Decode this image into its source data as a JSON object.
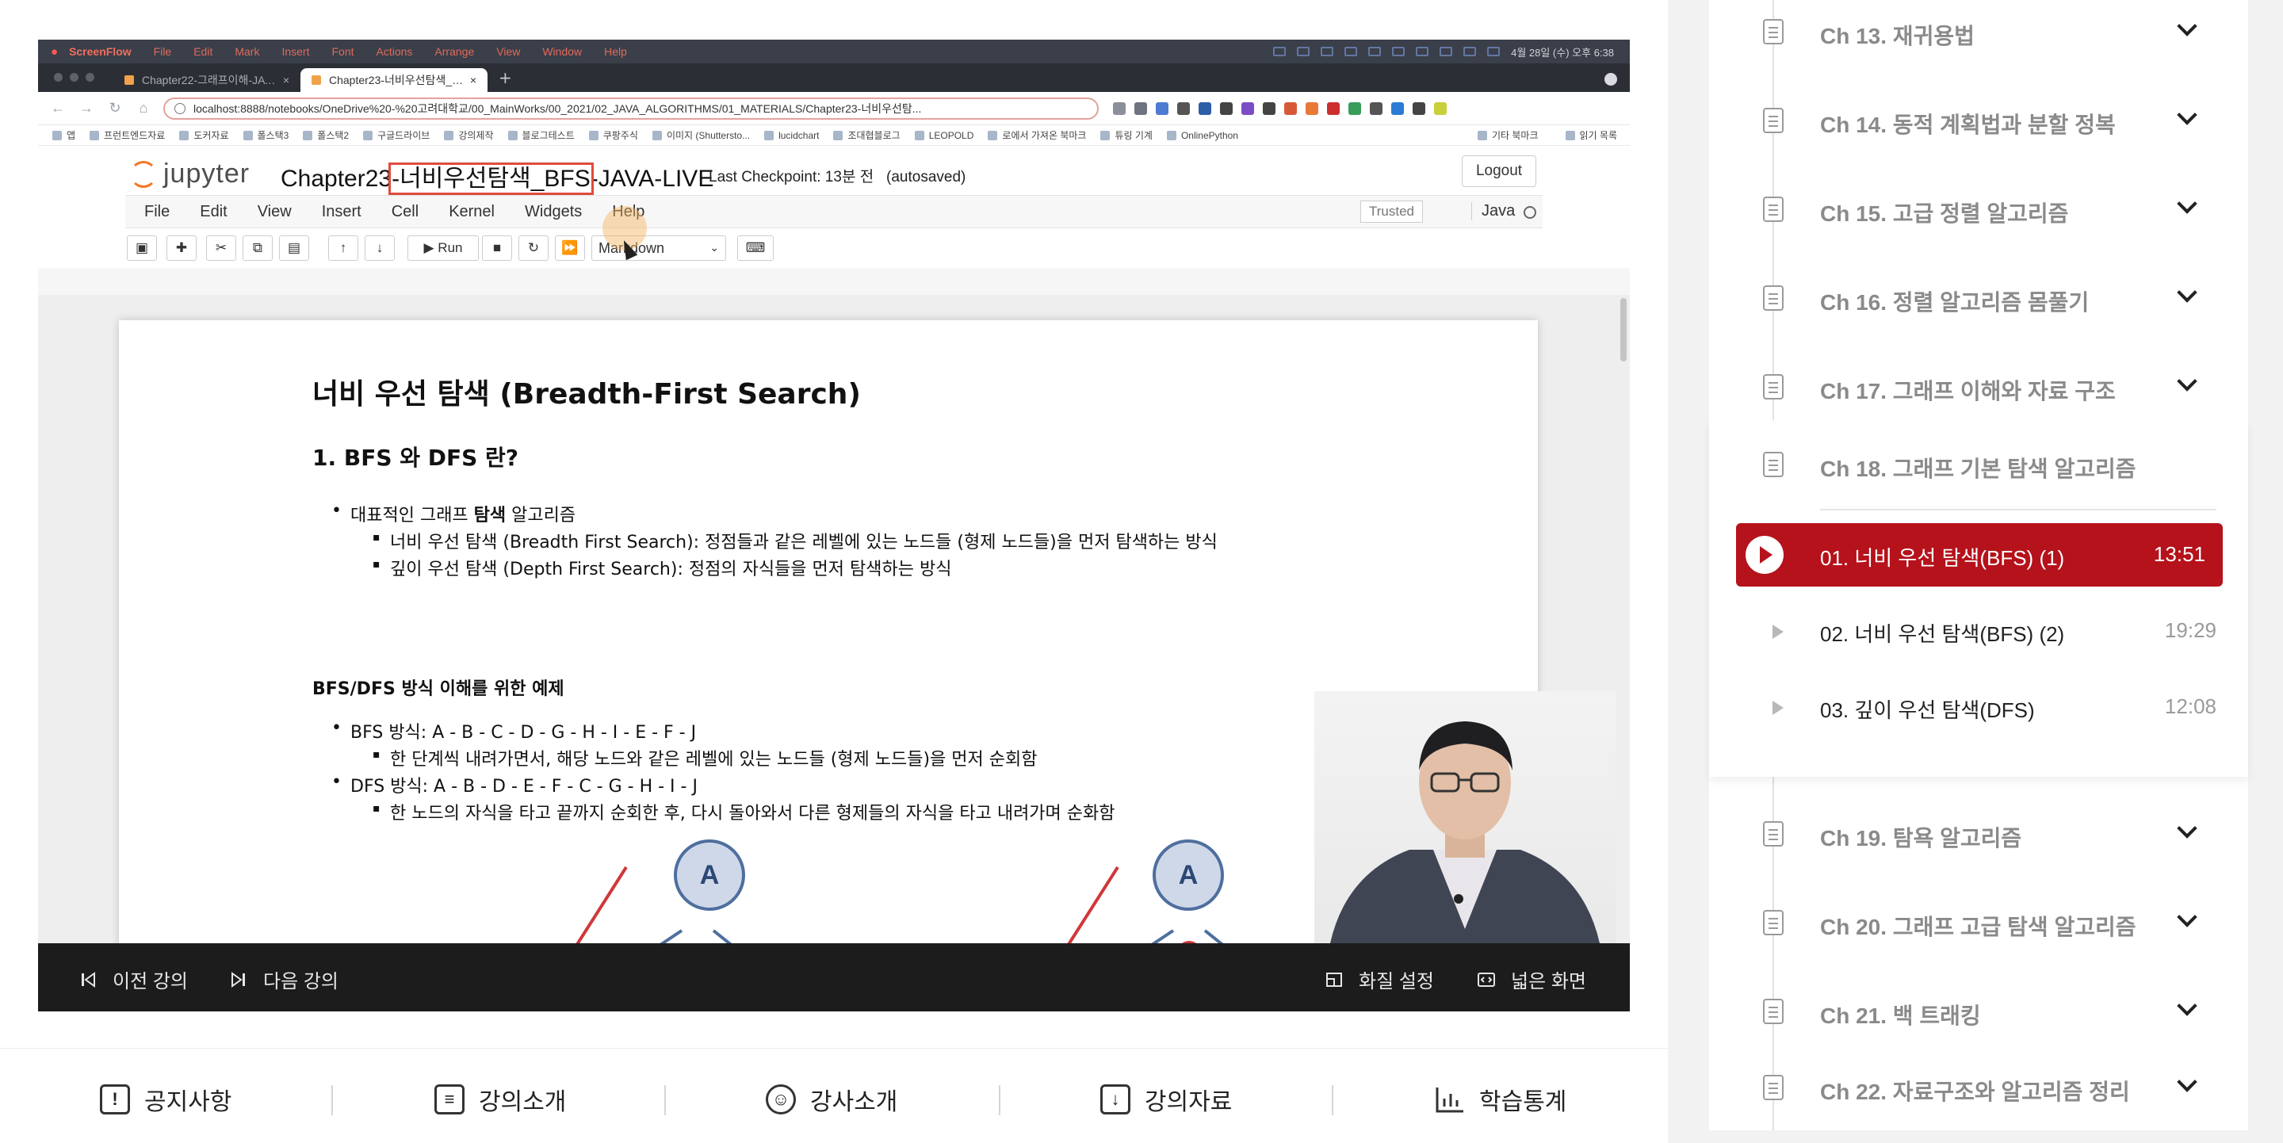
{
  "mac_menubar": {
    "app": "ScreenFlow",
    "items": [
      "File",
      "Edit",
      "Mark",
      "Insert",
      "Font",
      "Actions",
      "Arrange",
      "View",
      "Window",
      "Help"
    ],
    "clock": "4월 28일 (수) 오후 6:38"
  },
  "browser": {
    "tabs": [
      {
        "label": "Chapter22-그래프이해-JAVA - J"
      },
      {
        "label": "Chapter23-너비우선탐색_BFS-J"
      }
    ],
    "url": "localhost:8888/notebooks/OneDrive%20-%20고려대학교/00_MainWorks/00_2021/02_JAVA_ALGORITHMS/01_MATERIALS/Chapter23-너비우선탐...",
    "bookmarks": [
      "앱",
      "프런트엔드자료",
      "도커자료",
      "폴스택3",
      "폴스택2",
      "구글드라이브",
      "강의제작",
      "블로그테스트",
      "쿠팡주식",
      "이미지 (Shuttersto...",
      "lucidchart",
      "조대협블로그",
      "LEOPOLD",
      "로에서 가져온 북마크",
      "튜링 기계",
      "OnlinePython"
    ],
    "bookmarks_right": [
      "기타 북마크",
      "읽기 목록"
    ]
  },
  "jupyter": {
    "logo": "jupyter",
    "title_prefix": "Chapter23",
    "title_highlight": "-너비우선탐색_BFS",
    "title_suffix": "-JAVA-LIVE",
    "checkpoint": "Last Checkpoint: 13분 전",
    "autosaved": "(autosaved)",
    "logout": "Logout",
    "menu": [
      "File",
      "Edit",
      "View",
      "Insert",
      "Cell",
      "Kernel",
      "Widgets",
      "Help"
    ],
    "trusted": "Trusted",
    "kernel": "Java",
    "run_label": "Run",
    "cell_type": "Markdown"
  },
  "notebook": {
    "h1": "너비 우선 탐색 (Breadth-First Search)",
    "h2": "1. BFS 와 DFS 란?",
    "intro_pre": "대표적인 그래프 ",
    "intro_bold": "탐색",
    "intro_post": " 알고리즘",
    "bfs_def": "너비 우선 탐색 (Breadth First Search): 정점들과 같은 레벨에 있는 노드들 (형제 노드들)을 먼저 탐색하는 방식",
    "dfs_def": "깊이 우선 탐색 (Depth First Search): 정점의 자식들을 먼저 탐색하는 방식",
    "h4": "BFS/DFS 방식 이해를 위한 예제",
    "bfs_order": "BFS 방식: A - B - C - D - G - H - I - E - F - J",
    "bfs_desc": "한 단계씩 내려가면서, 해당 노드와 같은 레벨에 있는 노드들 (형제 노드들)을 먼저 순회함",
    "dfs_order": "DFS 방식: A - B - D - E - F - C - G - H - I - J",
    "dfs_desc": "한 노드의 자식을 타고 끝까지 순회한 후, 다시 돌아와서 다른 형제들의 자식을 타고 내려가며 순화함",
    "node_left": "A",
    "node_right": "A"
  },
  "player": {
    "prev": "이전 강의",
    "next": "다음 강의",
    "quality": "화질 설정",
    "wide": "넓은 화면"
  },
  "bottom_tabs": [
    {
      "label": "공지사항",
      "icon": "notice-icon"
    },
    {
      "label": "강의소개",
      "icon": "clipboard-icon"
    },
    {
      "label": "강사소개",
      "icon": "user-circle-icon"
    },
    {
      "label": "강의자료",
      "icon": "download-clipboard-icon"
    },
    {
      "label": "학습통계",
      "icon": "stats-icon"
    }
  ],
  "curriculum": {
    "chapters_before": [
      {
        "title": "Ch 13. 재귀용법"
      },
      {
        "title": "Ch 14. 동적 계획법과 분할 정복"
      },
      {
        "title": "Ch 15. 고급 정렬 알고리즘"
      },
      {
        "title": "Ch 16. 정렬 알고리즘 몸풀기"
      },
      {
        "title": "Ch 17. 그래프 이해와 자료 구조"
      }
    ],
    "current_chapter": "Ch 18. 그래프 기본 탐색 알고리즘",
    "lessons": [
      {
        "title": "01. 너비 우선 탐색(BFS) (1)",
        "duration": "13:51",
        "active": true
      },
      {
        "title": "02. 너비 우선 탐색(BFS) (2)",
        "duration": "19:29",
        "active": false
      },
      {
        "title": "03. 깊이 우선 탐색(DFS)",
        "duration": "12:08",
        "active": false
      }
    ],
    "chapters_after": [
      {
        "title": "Ch 19. 탐욕 알고리즘"
      },
      {
        "title": "Ch 20. 그래프 고급 탐색 알고리즘"
      },
      {
        "title": "Ch 21. 백 트래킹"
      },
      {
        "title": "Ch 22. 자료구조와 알고리즘 정리"
      }
    ]
  },
  "colors": {
    "accent": "#b5121b",
    "jupyter_orange": "#f37726"
  }
}
